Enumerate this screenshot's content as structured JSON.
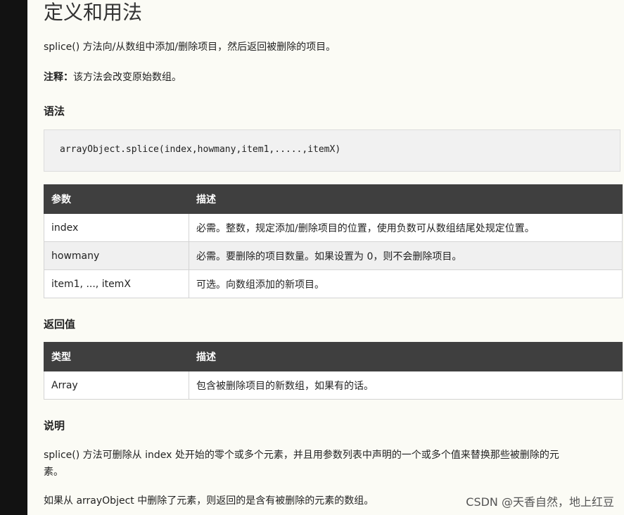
{
  "title": "定义和用法",
  "intro": "splice() 方法向/从数组中添加/删除项目，然后返回被删除的项目。",
  "note": {
    "label": "注释：",
    "text": "该方法会改变原始数组。"
  },
  "syntax": {
    "heading": "语法",
    "code": "arrayObject.splice(index,howmany,item1,.....,itemX)"
  },
  "params_table": {
    "headers": [
      "参数",
      "描述"
    ],
    "rows": [
      [
        "index",
        "必需。整数，规定添加/删除项目的位置，使用负数可从数组结尾处规定位置。"
      ],
      [
        "howmany",
        "必需。要删除的项目数量。如果设置为 0，则不会删除项目。"
      ],
      [
        "item1, ..., itemX",
        "可选。向数组添加的新项目。"
      ]
    ]
  },
  "return_value": {
    "heading": "返回值",
    "headers": [
      "类型",
      "描述"
    ],
    "rows": [
      [
        "Array",
        "包含被删除项目的新数组，如果有的话。"
      ]
    ]
  },
  "description": {
    "heading": "说明",
    "paragraph1_line1": "splice() 方法可删除从 index 处开始的零个或多个元素，并且用参数列表中声明的一个或多个值来替换那些被删除的元",
    "paragraph1_line2": "素。",
    "paragraph2": "如果从 arrayObject 中删除了元素，则返回的是含有被删除的元素的数组。"
  },
  "watermark": "CSDN @天香自然，地上红豆"
}
